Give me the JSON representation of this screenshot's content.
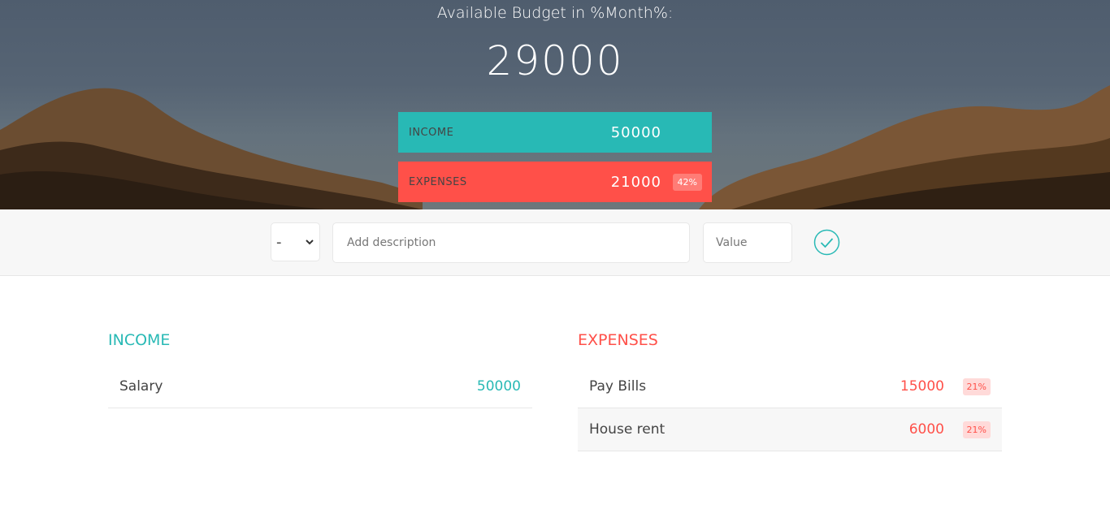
{
  "header": {
    "budget_title": "Available Budget in %Month%:",
    "budget_value": "29000",
    "income": {
      "label": "INCOME",
      "value": "50000"
    },
    "expenses": {
      "label": "EXPENSES",
      "value": "21000",
      "percentage": "42%"
    }
  },
  "add_form": {
    "type_selected": "-",
    "description_placeholder": "Add description",
    "value_placeholder": "Value",
    "submit_icon": "checkmark-circle-icon"
  },
  "income_list": {
    "title": "INCOME",
    "items": [
      {
        "description": "Salary",
        "value": "50000"
      }
    ]
  },
  "expenses_list": {
    "title": "EXPENSES",
    "items": [
      {
        "description": "Pay Bills",
        "value": "15000",
        "percentage": "21%"
      },
      {
        "description": "House rent",
        "value": "6000",
        "percentage": "21%"
      }
    ]
  },
  "colors": {
    "income": "#28b9b5",
    "expenses": "#ff5049",
    "add_bar_bg": "#f7f7f7"
  }
}
